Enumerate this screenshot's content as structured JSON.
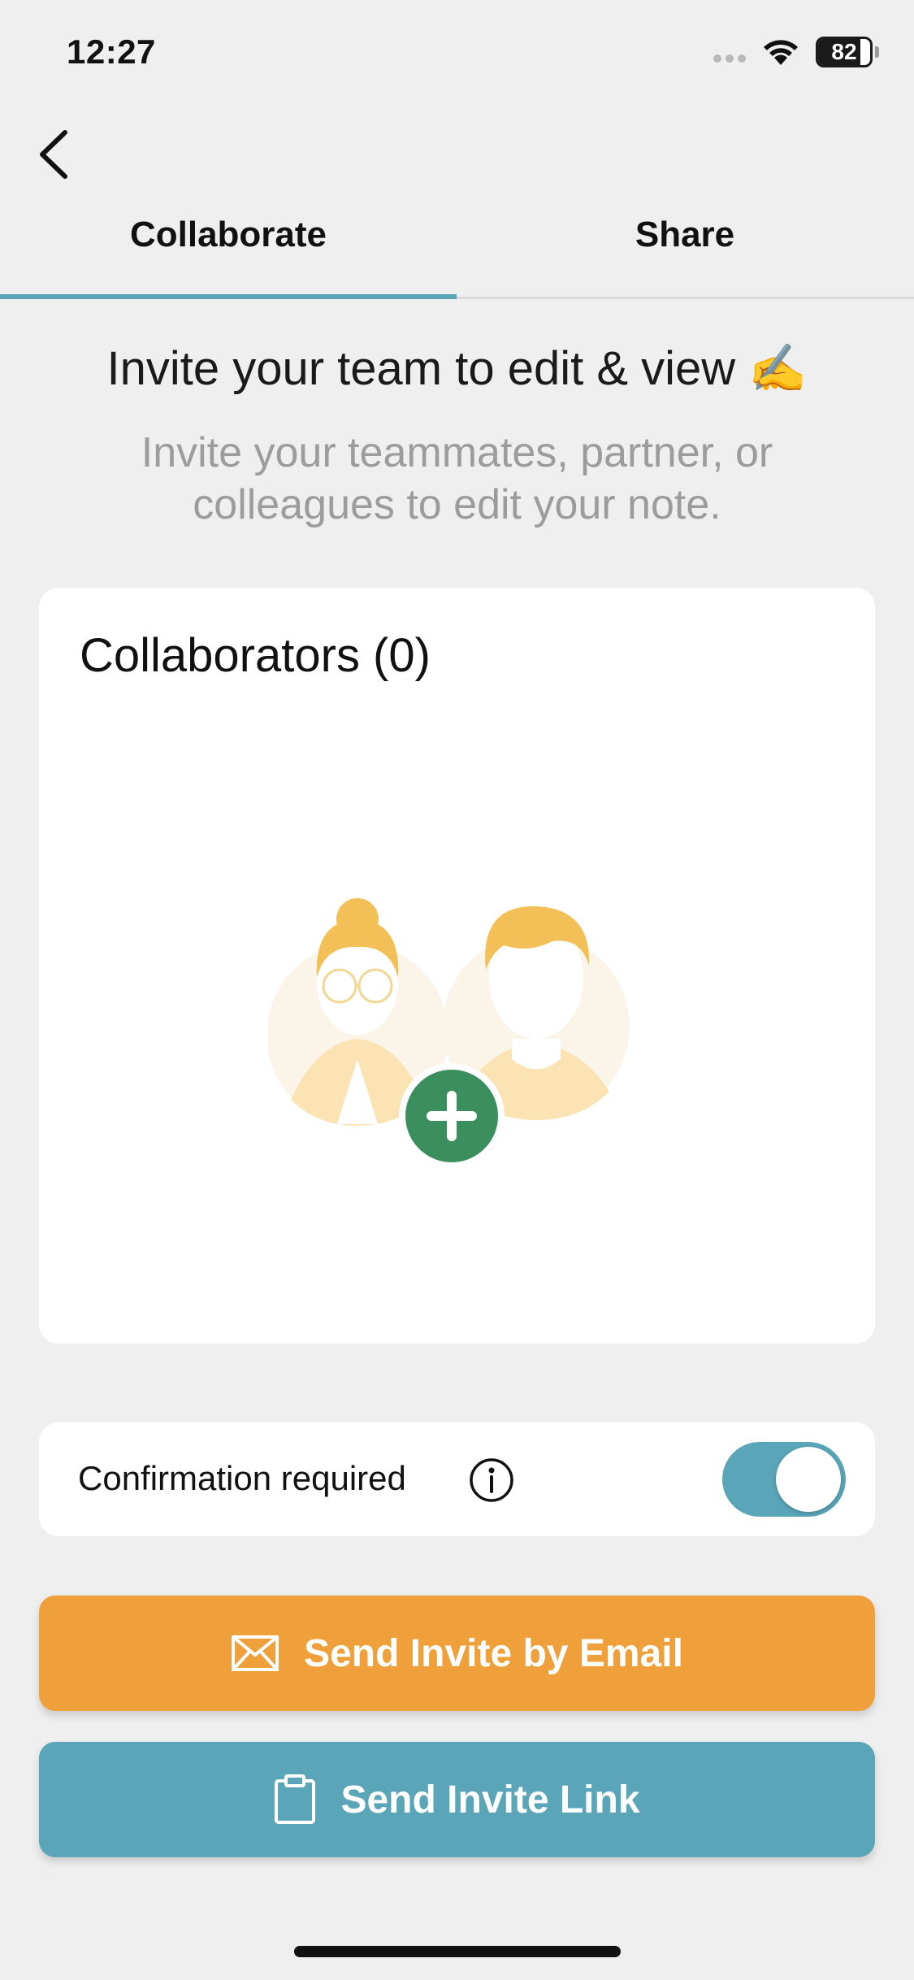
{
  "status_bar": {
    "time": "12:27",
    "battery": "82",
    "battery_level": 0.82
  },
  "nav": {
    "back_icon": "chevron-left-icon"
  },
  "tabs": [
    {
      "label": "Collaborate",
      "active": true
    },
    {
      "label": "Share",
      "active": false
    }
  ],
  "heading": {
    "title": "Invite your team to edit & view ✍️",
    "subtitle": "Invite your teammates, partner, or colleagues to edit your note."
  },
  "collaborators": {
    "title": "Collaborators (0)",
    "add_icon": "plus-icon"
  },
  "confirmation": {
    "label": "Confirmation required",
    "enabled": true,
    "info_icon": "info-icon"
  },
  "actions": {
    "email_label": "Send Invite by Email",
    "email_icon": "envelope-icon",
    "link_label": "Send Invite Link",
    "link_icon": "clipboard-icon"
  },
  "colors": {
    "accent": "#5aa5b8",
    "email": "#f0a03a",
    "add": "#3a8f5c"
  }
}
